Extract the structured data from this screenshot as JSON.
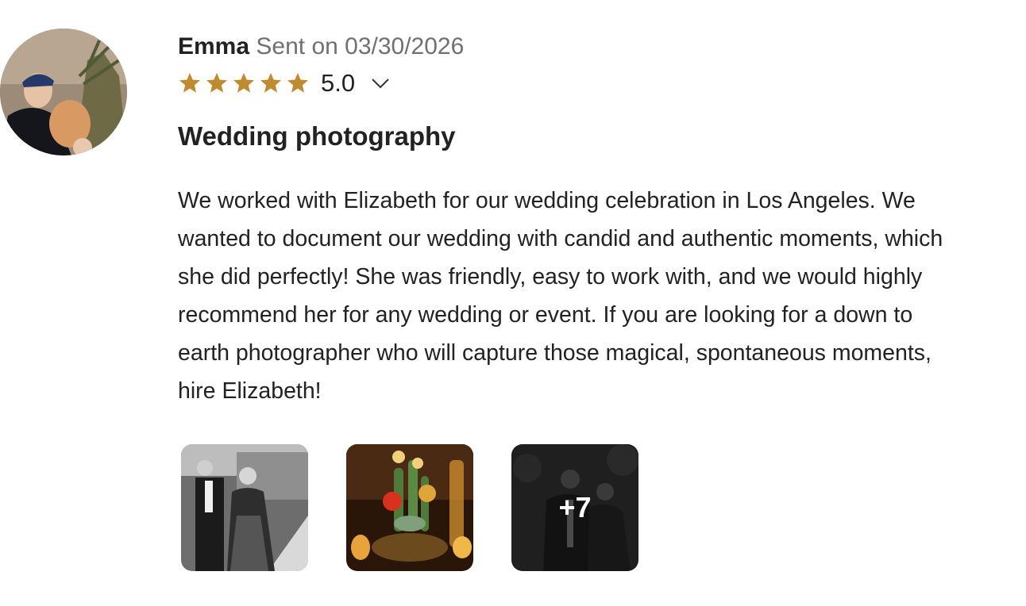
{
  "review": {
    "author": "Emma",
    "sent_text": "Sent on 03/30/2026",
    "rating": 5,
    "rating_label": "5.0",
    "title": "Wedding photography",
    "body_lines": [
      "We worked with Elizabeth for our wedding celebration in Los Angeles. We",
      "wanted to document our wedding with candid and authentic moments, which",
      "she did perfectly! She was friendly, easy to work with, and we would highly",
      "recommend her for any wedding or event. If you are looking for a down to",
      "earth photographer who will capture those magical, spontaneous moments,",
      "hire Elizabeth!"
    ],
    "photos_more_label": "+7"
  },
  "colors": {
    "star": "#C08A2E",
    "author": "#222222",
    "muted": "#707070"
  },
  "icons": {
    "star": "star-icon",
    "expand": "chevron-down-icon"
  }
}
